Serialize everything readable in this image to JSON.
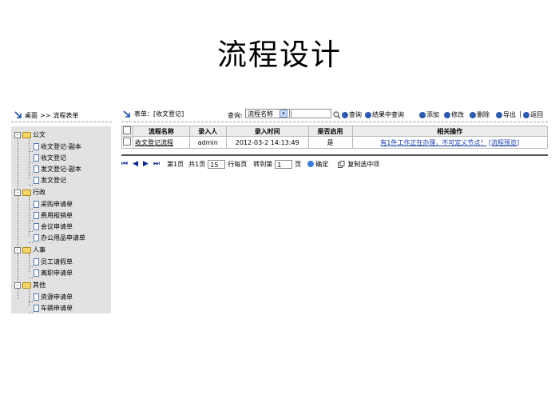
{
  "slide_title": "流程设计",
  "left": {
    "breadcrumb_home": "桌面",
    "breadcrumb_sep": ">>",
    "breadcrumb_current": "流程表单",
    "tree": [
      {
        "label": "公文",
        "children": [
          "收文登记-副本",
          "收文登记",
          "发文登记-副本",
          "发文登记"
        ]
      },
      {
        "label": "行政",
        "children": [
          "采购申请单",
          "费用报销单",
          "会议申请单",
          "办公用品申请单"
        ]
      },
      {
        "label": "人事",
        "children": [
          "员工请假单",
          "离职申请单"
        ]
      },
      {
        "label": "其他",
        "children": [
          "资源申请单",
          "车辆申请单"
        ]
      }
    ]
  },
  "header": {
    "form_label": "表单：[收文登记]",
    "query_label": "查询:",
    "query_select": "流程名称",
    "search_btn": "查询",
    "search_in_results_btn": "结果中查询",
    "add_btn": "添加",
    "edit_btn": "修改",
    "delete_btn": "删除",
    "export_btn": "导出",
    "back_btn": "返回"
  },
  "table": {
    "columns": [
      "流程名称",
      "录入人",
      "录入时间",
      "是否启用",
      "相关操作"
    ],
    "rows": [
      {
        "name": "收文登记流程",
        "creator": "admin",
        "time": "2012-03-2 14:13:49",
        "enabled": "是",
        "action_text": "有1件工作正在办理，不可定义节点！",
        "action_link": "[流程预览]"
      }
    ]
  },
  "pager": {
    "page_prefix": "第1页",
    "total": "共1页",
    "per_page_value": "15",
    "per_page_label": "行每页",
    "goto_label": "转到第",
    "goto_value": "1",
    "goto_suffix": "页",
    "confirm_btn": "确定",
    "copy_btn": "复制选中项"
  },
  "colors": {
    "accent": "#2d5bab",
    "tree_bg": "#e2e2e2",
    "link": "#1a3db0"
  }
}
